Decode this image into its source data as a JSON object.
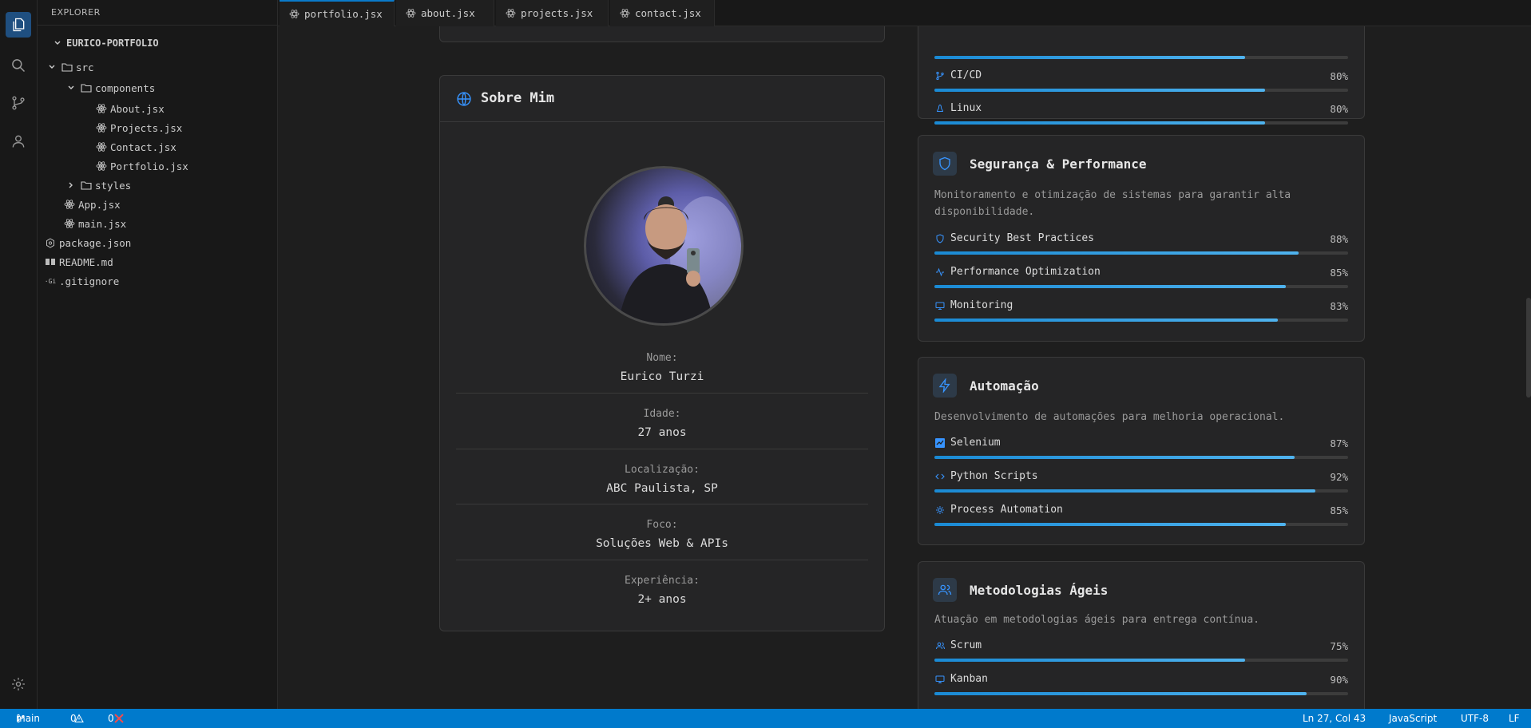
{
  "explorer": {
    "title": "EXPLORER",
    "root": "EURICO-PORTFOLIO",
    "tree": [
      {
        "label": "src",
        "kind": "folder-open"
      },
      {
        "label": "components",
        "kind": "folder-open"
      },
      {
        "label": "About.jsx",
        "kind": "react"
      },
      {
        "label": "Projects.jsx",
        "kind": "react"
      },
      {
        "label": "Contact.jsx",
        "kind": "react"
      },
      {
        "label": "Portfolio.jsx",
        "kind": "react"
      },
      {
        "label": "styles",
        "kind": "folder"
      },
      {
        "label": "App.jsx",
        "kind": "react"
      },
      {
        "label": "main.jsx",
        "kind": "react"
      },
      {
        "label": "package.json",
        "kind": "json"
      },
      {
        "label": "README.md",
        "kind": "readme"
      },
      {
        "label": ".gitignore",
        "kind": "git"
      }
    ]
  },
  "tabs": [
    {
      "label": "portfolio.jsx",
      "active": true
    },
    {
      "label": "about.jsx",
      "active": false
    },
    {
      "label": "projects.jsx",
      "active": false
    },
    {
      "label": "contact.jsx",
      "active": false
    }
  ],
  "about": {
    "title": "Sobre Mim",
    "fields": [
      {
        "label": "Nome:",
        "value": "Eurico Turzi"
      },
      {
        "label": "Idade:",
        "value": "27 anos"
      },
      {
        "label": "Localização:",
        "value": "ABC Paulista, SP"
      },
      {
        "label": "Foco:",
        "value": "Soluções Web & APIs"
      },
      {
        "label": "Experiência:",
        "value": "2+ anos"
      }
    ]
  },
  "top_skills": [
    {
      "name": "CI/CD",
      "pct": "80%",
      "level": 0.8,
      "icon": "git-branch-icon"
    },
    {
      "name": "Linux",
      "pct": "80%",
      "level": 0.8,
      "icon": "linux-icon"
    }
  ],
  "top_partial_level": 0.75,
  "sections": [
    {
      "title": "Segurança & Performance",
      "icon": "shield-icon",
      "desc": "Monitoramento e otimização de sistemas para garantir alta disponibilidade.",
      "skills": [
        {
          "name": "Security Best Practices",
          "pct": "88%",
          "level": 0.88,
          "icon": "shield-icon"
        },
        {
          "name": "Performance Optimization",
          "pct": "85%",
          "level": 0.85,
          "icon": "activity-icon"
        },
        {
          "name": "Monitoring",
          "pct": "83%",
          "level": 0.83,
          "icon": "monitor-icon"
        }
      ]
    },
    {
      "title": "Automação",
      "icon": "lightning-icon",
      "desc": "Desenvolvimento de automações para melhoria operacional.",
      "skills": [
        {
          "name": "Selenium",
          "pct": "87%",
          "level": 0.87,
          "icon": "selenium-icon"
        },
        {
          "name": "Python Scripts",
          "pct": "92%",
          "level": 0.92,
          "icon": "code-icon"
        },
        {
          "name": "Process Automation",
          "pct": "85%",
          "level": 0.85,
          "icon": "gear-icon"
        }
      ]
    },
    {
      "title": "Metodologias Ágeis",
      "icon": "users-icon",
      "desc": "Atuação em metodologias ágeis para entrega contínua.",
      "skills": [
        {
          "name": "Scrum",
          "pct": "75%",
          "level": 0.75,
          "icon": "users-icon"
        },
        {
          "name": "Kanban",
          "pct": "90%",
          "level": 0.9,
          "icon": "monitor-icon"
        }
      ]
    }
  ],
  "status": {
    "branch": "main",
    "warnings": "0",
    "errors": "0",
    "position": "Ln 27, Col 43",
    "language": "JavaScript",
    "encoding": "UTF-8",
    "eol": "LF"
  },
  "colors": {
    "accent": "#007acc",
    "bar": "#1a8ad4",
    "error": "#f14c4c"
  }
}
